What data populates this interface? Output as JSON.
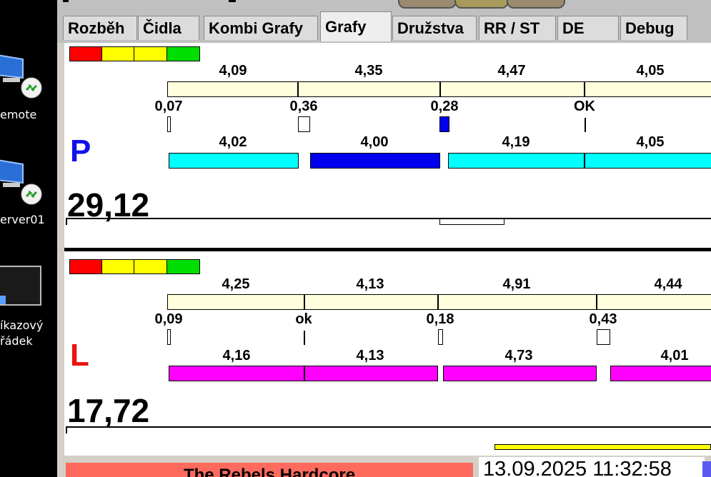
{
  "desktop": {
    "icons": [
      {
        "label": "emote",
        "icon": "remote-desktop-icon"
      },
      {
        "label": "erver01",
        "icon": "remote-desktop-icon"
      },
      {
        "label_line1": "íkazový",
        "label_line2": "řádek",
        "icon": "command-prompt-icon"
      }
    ]
  },
  "tabs": [
    "Rozběh",
    "Čidla",
    "Kombi Grafy",
    "Grafy",
    "Družstva",
    "RR / ST",
    "DE",
    "Debug"
  ],
  "active_tab": "Grafy",
  "colors": {
    "status": [
      "#ff0000",
      "#ffff00",
      "#ffff00",
      "#00dd00"
    ],
    "split_bar": "#ffffdd",
    "p_letter": "#1010ee",
    "l_letter": "#ee1010",
    "p_bar": "#00ffff",
    "p_bar_highlight": "#0000ee",
    "l_bar": "#ff00ff",
    "diff_marker": "#0000ee",
    "footer_bar": "#ffff00"
  },
  "lane_p": {
    "letter": "P",
    "total": "29,12",
    "top_values": [
      "4,09",
      "4,35",
      "4,47",
      "4,05"
    ],
    "diffs": [
      "0,07",
      "0,36",
      "0,28",
      "OK"
    ],
    "bottom_values": [
      "4,02",
      "4,00",
      "4,19",
      "4,05"
    ]
  },
  "lane_l": {
    "letter": "L",
    "total": "17,72",
    "top_values": [
      "4,25",
      "4,13",
      "4,91",
      "4,44"
    ],
    "diffs": [
      "0,09",
      "ok",
      "0,18",
      "0,43"
    ],
    "bottom_values": [
      "4,16",
      "4,13",
      "4,73",
      "4,01"
    ]
  },
  "footer": {
    "team_name": "The Rebels Hardcore",
    "datetime": "13.09.2025 11:32:58"
  }
}
